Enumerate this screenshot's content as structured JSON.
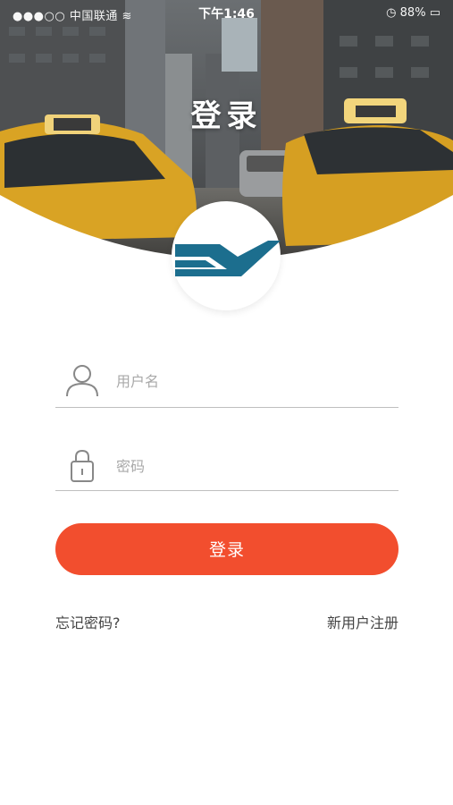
{
  "status_bar": {
    "carrier": "中国联通",
    "time": "下午1:46",
    "battery": "88%"
  },
  "header": {
    "title": "登录"
  },
  "login_form": {
    "username_placeholder": "用户名",
    "password_placeholder": "密码",
    "submit_label": "登录"
  },
  "links": {
    "forgot_password": "忘记密码?",
    "register": "新用户注册"
  },
  "colors": {
    "primary_button": "#f24e2e",
    "logo_blue": "#1c6e8e"
  }
}
